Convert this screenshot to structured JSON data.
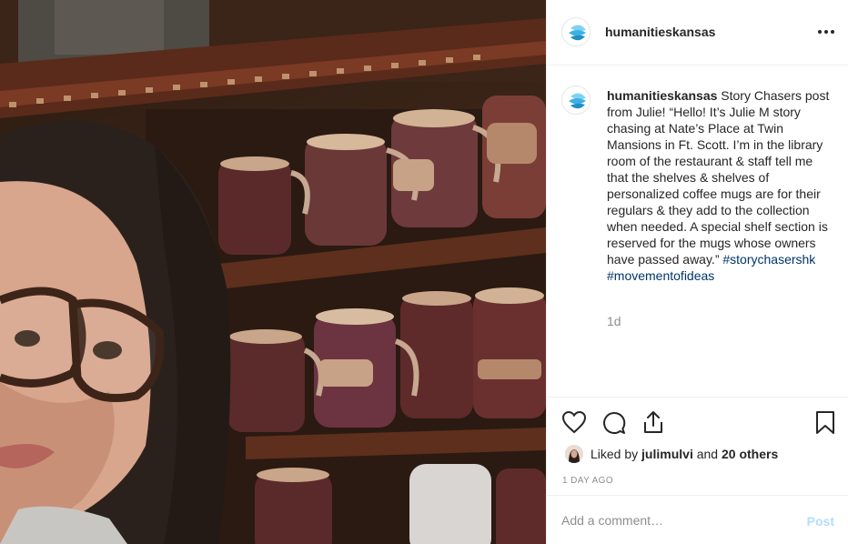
{
  "post": {
    "username": "humanitieskansas",
    "caption_text": "Story Chasers post from Julie! “Hello! It’s Julie M story chasing at Nate’s Place at Twin Mansions in Ft. Scott. I’m in the library room of the restaurant & staff tell me that the shelves & shelves of personalized coffee mugs are for their regulars & they add to the collection when needed. A special shelf section is reserved for the mugs whose owners have passed away.”",
    "hashtags": [
      "#storychasershk",
      "#movementofideas"
    ],
    "time_ago": "1d",
    "photo_alt": "Selfie of a woman with glasses in front of shelves of personalized coffee mugs"
  },
  "actions": {
    "like_icon": "heart-icon",
    "comment_icon": "comment-bubble-icon",
    "share_icon": "share-icon",
    "save_icon": "bookmark-icon"
  },
  "likes": {
    "prefix": "Liked by",
    "first_user": "julimulvi",
    "conjunction": "and",
    "others": "20 others"
  },
  "posted_date": "1 DAY AGO",
  "comment": {
    "placeholder": "Add a comment…",
    "post_label": "Post"
  },
  "colors": {
    "text": "#262626",
    "muted": "#8e8e8e",
    "hashtag": "#003569",
    "post_button_disabled": "#b2dffc",
    "border": "#efefef",
    "logo_blue_light": "#5bc3ec",
    "logo_blue_dark": "#1f8fc6"
  }
}
